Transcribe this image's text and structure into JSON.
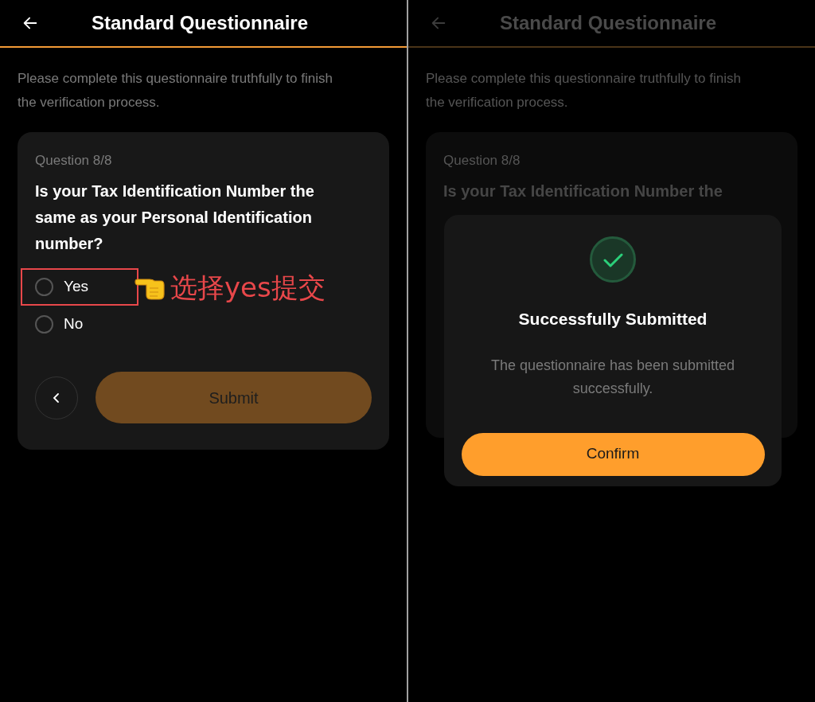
{
  "left_screen": {
    "header": {
      "title": "Standard Questionnaire"
    },
    "intro": "Please complete this questionnaire truthfully to finish the verification process.",
    "card": {
      "counter": "Question 8/8",
      "question": "Is your Tax Identification Number the same as your Personal Identification number?",
      "options": [
        {
          "label": "Yes",
          "selected": false,
          "annotated": true
        },
        {
          "label": "No",
          "selected": false,
          "annotated": false
        }
      ],
      "submit_button": "Submit"
    },
    "annotation": {
      "text": "选择yes提交"
    }
  },
  "right_screen": {
    "header": {
      "title": "Standard Questionnaire"
    },
    "intro": "Please complete this questionnaire truthfully to finish the verification process.",
    "card": {
      "counter": "Question 8/8",
      "question": "Is your Tax Identification Number the"
    },
    "dialog": {
      "title": "Successfully Submitted",
      "message": "The questionnaire has been submitted successfully.",
      "confirm_button": "Confirm"
    }
  }
}
